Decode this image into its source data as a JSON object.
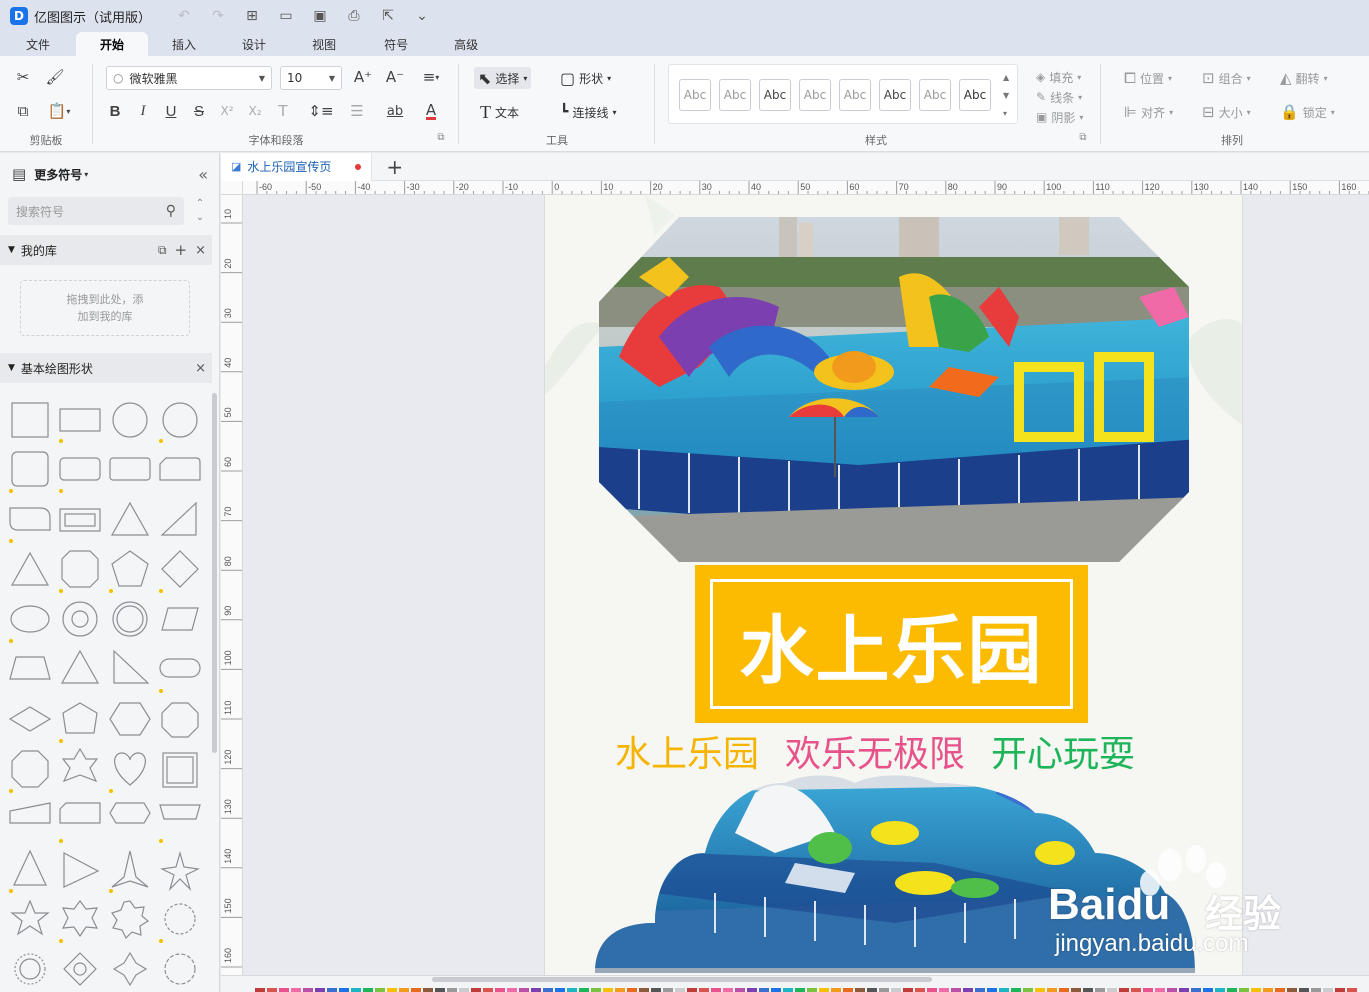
{
  "app": {
    "logo": "D",
    "title": "亿图图示（试用版）"
  },
  "quick_access": [
    "undo-icon",
    "redo-icon",
    "new-icon",
    "open-icon",
    "save-icon",
    "print-icon",
    "export-icon",
    "more-icon"
  ],
  "menu": {
    "tabs": [
      "文件",
      "开始",
      "插入",
      "设计",
      "视图",
      "符号",
      "高级"
    ],
    "active": "开始"
  },
  "ribbon": {
    "clipboard": {
      "label": "剪贴板"
    },
    "font": {
      "label": "字体和段落",
      "family": "微软雅黑",
      "size": "10",
      "buttons": [
        "B",
        "I",
        "U",
        "S"
      ]
    },
    "tools": {
      "label": "工具",
      "select": "选择",
      "shape": "形状",
      "text": "文本",
      "connector": "连接线"
    },
    "styles": {
      "label": "样式",
      "samples": [
        "Abc",
        "Abc",
        "Abc",
        "Abc",
        "Abc",
        "Abc",
        "Abc",
        "Abc"
      ],
      "fill": "填充",
      "line": "线条",
      "shadow": "阴影"
    },
    "arrange": {
      "label": "排列",
      "position": "位置",
      "group": "组合",
      "flip": "翻转",
      "align": "对齐",
      "size": "大小",
      "lock": "锁定"
    }
  },
  "left_panel": {
    "title": "更多符号",
    "search_placeholder": "搜索符号",
    "my_library": {
      "title": "我的库",
      "drop_hint_1": "拖拽到此处，添",
      "drop_hint_2": "加到我的库"
    },
    "basic_shapes": {
      "title": "基本绘图形状"
    }
  },
  "doc": {
    "tab_title": "水上乐园宣传页",
    "modified": true
  },
  "ruler_h": [
    "-60",
    "-50",
    "-40",
    "-30",
    "-20",
    "-10",
    "0",
    "10",
    "20",
    "30",
    "40",
    "50",
    "60",
    "70",
    "80",
    "90",
    "100",
    "110",
    "120",
    "130",
    "140",
    "150",
    "160"
  ],
  "ruler_v": [
    "10",
    "20",
    "30",
    "40",
    "50",
    "60",
    "70",
    "80",
    "90",
    "100",
    "110",
    "120",
    "130",
    "140",
    "150",
    "160"
  ],
  "poster": {
    "title": "水上乐园",
    "slogan": [
      {
        "text": "水上乐园",
        "color": "#f5b400"
      },
      {
        "text": "欢乐无极限",
        "color": "#e8528a"
      },
      {
        "text": "开心玩耍",
        "color": "#1db45a"
      }
    ],
    "banner_color": "#fdbb00"
  },
  "watermark": {
    "brand": "Baidu",
    "cn": "经验",
    "url": "jingyan.baidu.com"
  }
}
